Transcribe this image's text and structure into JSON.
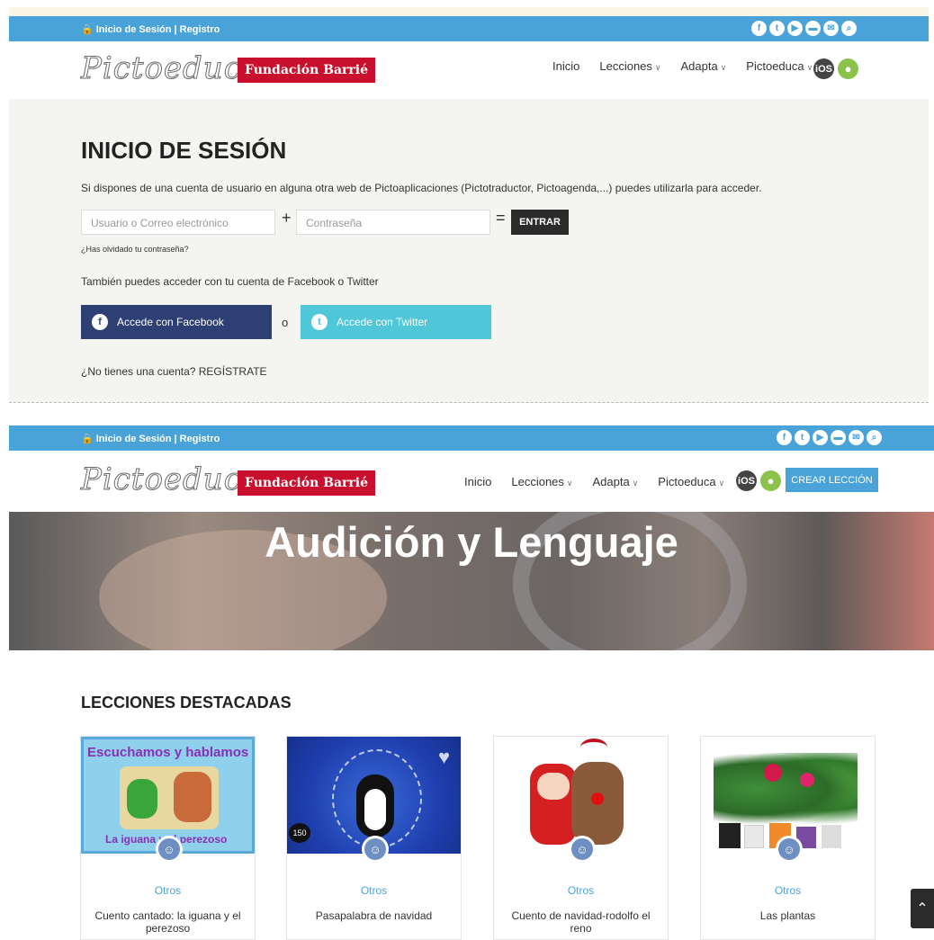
{
  "top": {
    "topbar": {
      "login_text": "🔒 Inicio de Sesión | Registro",
      "social_icons": [
        "f",
        "t",
        "▶",
        "▬",
        "✉",
        "⌕"
      ]
    },
    "header": {
      "logo": "Pictoeduca",
      "brand": "Fundación Barrié",
      "nav": {
        "inicio": "Inicio",
        "lecciones": "Lecciones",
        "adapta": "Adapta",
        "pictoeduca": "Pictoeduca",
        "ios": "iOS"
      }
    }
  },
  "login": {
    "title": "INICIO DE SESIÓN",
    "description": "Si dispones de una cuenta de usuario en alguna otra web de Pictoaplicaciones (Pictotraductor, Pictoagenda,...) puedes utilizarla para acceder.",
    "user_placeholder": "Usuario o Correo electrónico",
    "plus": "+",
    "password_placeholder": "Contraseña",
    "equals": "=",
    "submit": "ENTRAR",
    "forgot": "¿Has olvidado tu contraseña?",
    "social_prompt": "También puedes acceder con tu cuenta de Facebook o Twitter",
    "facebook": "Accede con Facebook",
    "or": "o",
    "twitter": "Accede con Twitter",
    "no_account": "¿No tienes una cuenta? REGÍSTRATE"
  },
  "bottom": {
    "topbar": {
      "login_text": "🔒 Inicio de Sesión | Registro"
    },
    "header": {
      "logo": "Pictoeduca",
      "brand": "Fundación Barrié",
      "nav": {
        "inicio": "Inicio",
        "lecciones": "Lecciones",
        "adapta": "Adapta",
        "pictoeduca": "Pictoeduca",
        "ios": "iOS"
      },
      "create": "CREAR LECCIÓN"
    }
  },
  "hero": {
    "title": "Audición y Lenguaje"
  },
  "featured": {
    "title": "LECCIONES DESTACADAS",
    "cards": [
      {
        "category": "Otros",
        "title": "Cuento cantado: la iguana y el perezoso",
        "img_top": "Escuchamos y hablamos",
        "img_bottom": "La iguana y el perezoso"
      },
      {
        "category": "Otros",
        "title": "Pasapalabra de navidad",
        "img_badge": "150"
      },
      {
        "category": "Otros",
        "title": "Cuento de navidad-rodolfo el reno"
      },
      {
        "category": "Otros",
        "title": "Las plantas"
      }
    ]
  },
  "scroll_top": "⌃",
  "colors": {
    "topbar": "#4aa3d8",
    "brand_red": "#c8102e",
    "facebook": "#2d3f73",
    "twitter": "#4fc7d8"
  }
}
